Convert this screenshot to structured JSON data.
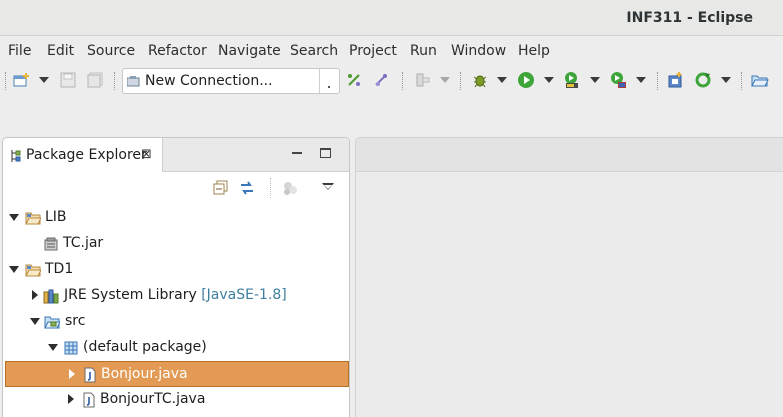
{
  "window": {
    "title": "INF311 - Eclipse"
  },
  "menubar": {
    "items": [
      "File",
      "Edit",
      "Source",
      "Refactor",
      "Navigate",
      "Search",
      "Project",
      "Run",
      "Window",
      "Help"
    ]
  },
  "toolbar": {
    "connection_combo": {
      "value": "New Connection..."
    }
  },
  "package_explorer": {
    "tab_label": "Package Explorer",
    "close_glyph": "⊠",
    "tree": [
      {
        "label": "LIB",
        "decoration": "",
        "expanded": true,
        "icon": "project-folder-icon"
      },
      {
        "label": "TC.jar",
        "decoration": "",
        "icon": "jar-icon"
      },
      {
        "label": "TD1",
        "decoration": "",
        "expanded": true,
        "icon": "project-folder-icon"
      },
      {
        "label": "JRE System Library ",
        "decoration": "[JavaSE-1.8]",
        "expanded": false,
        "icon": "library-icon"
      },
      {
        "label": "src",
        "decoration": "",
        "expanded": true,
        "icon": "source-folder-icon"
      },
      {
        "label": "(default package)",
        "decoration": "",
        "expanded": true,
        "icon": "package-icon"
      },
      {
        "label": "Bonjour.java",
        "decoration": "",
        "expanded": false,
        "selected": true,
        "icon": "java-file-icon"
      },
      {
        "label": "BonjourTC.java",
        "decoration": "",
        "expanded": false,
        "icon": "java-file-icon"
      }
    ]
  },
  "colors": {
    "selection": "#e29a55",
    "decoration": "#3f7f9f"
  }
}
